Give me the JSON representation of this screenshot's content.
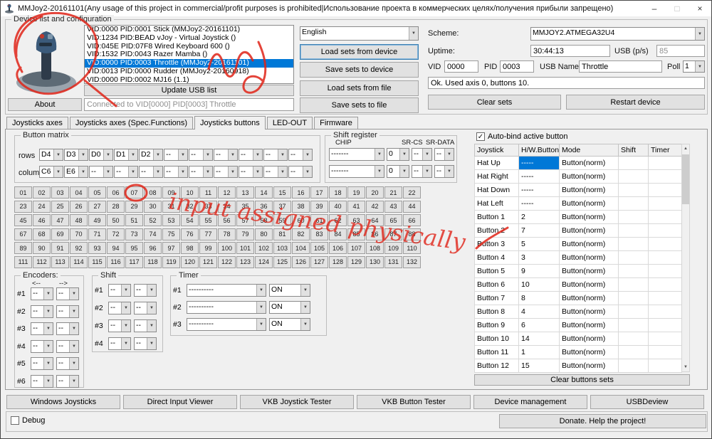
{
  "window": {
    "title": "MMJoy2-20161101(Any usage of this project in commercial/profit purposes is prohibited|Использование проекта в коммерческих целях/получения прибыли запрещено)",
    "minimize": "–",
    "maximize": "□",
    "close": "×"
  },
  "device_group": {
    "label": "Device list and configuration",
    "about_button": "About",
    "update_usb_button": "Update USB list",
    "connected_text": "Connected to VID[0000] PID[0003] Throttle",
    "language_value": "English",
    "devices": [
      "VID:0000 PID:0001 Stick (MMJoy2-20161101)",
      "VID:1234 PID:BEAD vJoy - Virtual Joystick ()",
      "VID:045E PID:07F8 Wired Keyboard 600 ()",
      "VID:1532 PID:0043 Razer Mamba ()",
      "VID:0000 PID:0003 Throttle (MMJoy2-20161101)",
      "VID:0013 PID:0000 Rudder (MMJoy2-20160918)",
      "VID:0000 PID:0002 MJ16 (1.1)"
    ],
    "selected_device_index": 4,
    "buttons": {
      "load_device": "Load sets from device",
      "save_device": "Save sets to device",
      "load_file": "Load sets from file",
      "save_file": "Save sets to file",
      "clear_sets": "Clear sets",
      "restart_device": "Restart device"
    },
    "fields": {
      "scheme_label": "Scheme:",
      "scheme_value": "MMJOY2.ATMEGA32U4",
      "uptime_label": "Uptime:",
      "uptime_value": "30:44:13",
      "usb_ps_label": "USB (p/s)",
      "usb_ps_value": "85",
      "vid_label": "VID",
      "vid_value": "0000",
      "pid_label": "PID",
      "pid_value": "0003",
      "usb_name_label": "USB Name",
      "usb_name_value": "Throttle",
      "poll_label": "Poll",
      "poll_value": "1",
      "status_value": "Ok. Used axis  0, buttons 10."
    }
  },
  "tabs": [
    {
      "label": "Joysticks axes",
      "active": false
    },
    {
      "label": "Joysticks axes (Spec.Functions)",
      "active": false
    },
    {
      "label": "Joysticks buttons",
      "active": true
    },
    {
      "label": "LED-OUT",
      "active": false
    },
    {
      "label": "Firmware",
      "active": false
    }
  ],
  "button_matrix": {
    "label": "Button matrix",
    "rows_label": "rows",
    "columns_label": "columns",
    "rows": [
      "D4",
      "D3",
      "D0",
      "D1",
      "D2",
      "--",
      "--",
      "--",
      "--",
      "--",
      "--"
    ],
    "columns": [
      "C6",
      "E6",
      "--",
      "--",
      "--",
      "--",
      "--",
      "--",
      "--",
      "--",
      "--"
    ]
  },
  "shift_register": {
    "label": "Shift register",
    "chip_label": "CHIP",
    "srcs_label": "SR-CS",
    "srdata_label": "SR-DATA",
    "rows": [
      {
        "chip": "-------",
        "num": "0",
        "cs": "--",
        "data": "--"
      },
      {
        "chip": "-------",
        "num": "0",
        "cs": "--",
        "data": "--"
      }
    ]
  },
  "button_grid": {
    "count": 132,
    "columns": 22
  },
  "encoders": {
    "label": "Encoders:",
    "left_arrow": "<--",
    "right_arrow": "-->",
    "rows": [
      "#1",
      "#2",
      "#3",
      "#4",
      "#5",
      "#6"
    ],
    "value": "--"
  },
  "shift_group": {
    "label": "Shift",
    "rows": [
      "#1",
      "#2",
      "#3",
      "#4"
    ],
    "value": "--"
  },
  "timer_group": {
    "label": "Timer",
    "rows": [
      "#1",
      "#2",
      "#3"
    ],
    "value": "----------",
    "on_value": "ON"
  },
  "bindings": {
    "autobind_label": "Auto-bind active button",
    "autobind_checked": true,
    "headers": [
      "Joystick",
      "H/W.Button",
      "Mode",
      "Shift",
      "Timer"
    ],
    "selected_cell": {
      "row": 0,
      "col": 1
    },
    "rows": [
      [
        "Hat Up",
        "-----",
        "Button(norm)",
        "",
        ""
      ],
      [
        "Hat Right",
        "-----",
        "Button(norm)",
        "",
        ""
      ],
      [
        "Hat Down",
        "-----",
        "Button(norm)",
        "",
        ""
      ],
      [
        "Hat Left",
        "-----",
        "Button(norm)",
        "",
        ""
      ],
      [
        "Button 1",
        "2",
        "Button(norm)",
        "",
        ""
      ],
      [
        "Button 2",
        "7",
        "Button(norm)",
        "",
        ""
      ],
      [
        "Button 3",
        "5",
        "Button(norm)",
        "",
        ""
      ],
      [
        "Button 4",
        "3",
        "Button(norm)",
        "",
        ""
      ],
      [
        "Button 5",
        "9",
        "Button(norm)",
        "",
        ""
      ],
      [
        "Button 6",
        "10",
        "Button(norm)",
        "",
        ""
      ],
      [
        "Button 7",
        "8",
        "Button(norm)",
        "",
        ""
      ],
      [
        "Button 8",
        "4",
        "Button(norm)",
        "",
        ""
      ],
      [
        "Button 9",
        "6",
        "Button(norm)",
        "",
        ""
      ],
      [
        "Button 10",
        "14",
        "Button(norm)",
        "",
        ""
      ],
      [
        "Button 11",
        "1",
        "Button(norm)",
        "",
        ""
      ],
      [
        "Button 12",
        "15",
        "Button(norm)",
        "",
        ""
      ]
    ],
    "clear_button": "Clear buttons sets"
  },
  "bottom": {
    "buttons": [
      "Windows Joysticks",
      "Direct Input Viewer",
      "VKB Joystick Tester",
      "VKB Button Tester",
      "Device management",
      "USBDeview"
    ],
    "debug_label": "Debug",
    "donate_button": "Donate. Help the project!"
  },
  "annotation": {
    "text": "input assigned physically",
    "color": "#e02418"
  }
}
